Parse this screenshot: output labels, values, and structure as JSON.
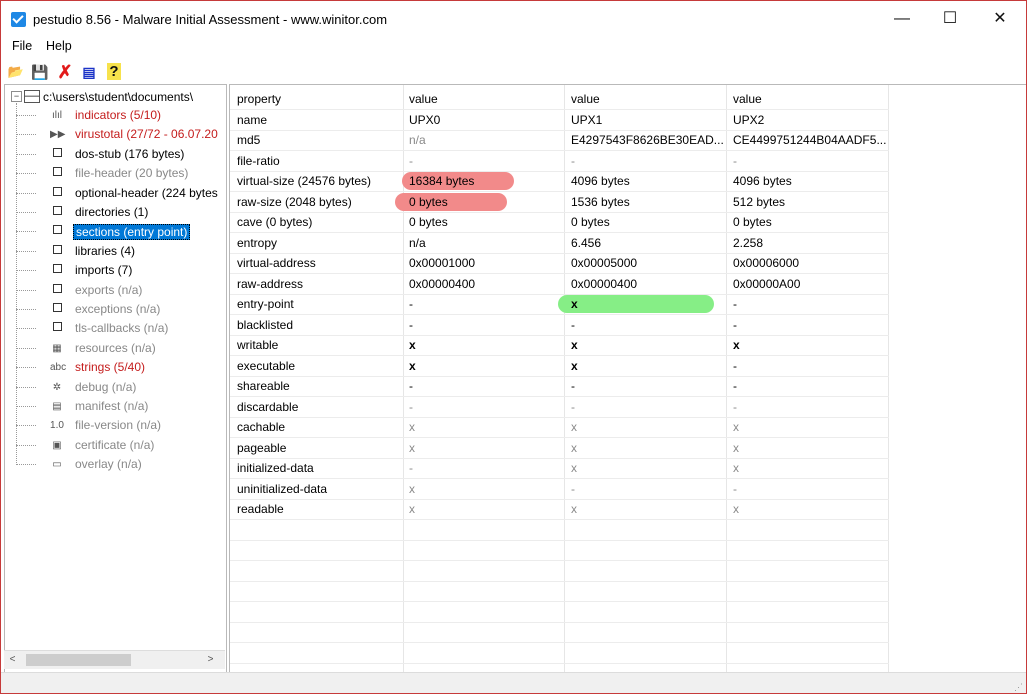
{
  "window": {
    "title": "pestudio 8.56 - Malware Initial Assessment - www.winitor.com",
    "min": "—",
    "max": "☐",
    "close": "✕"
  },
  "menu": {
    "file": "File",
    "help": "Help"
  },
  "toolbar": {
    "open_icon": "📂",
    "save_icon": "💾",
    "delete_icon": "✗",
    "list_icon": "▤",
    "help_icon": "?"
  },
  "tree": {
    "root": "c:\\users\\student\\documents\\",
    "items": [
      {
        "label": "indicators (5/10)",
        "color": "red",
        "icon": "ılıl",
        "icon_name": "bar-chart-icon"
      },
      {
        "label": "virustotal (27/72 - 06.07.20",
        "color": "red",
        "icon": "▶▶",
        "icon_name": "virustotal-icon"
      },
      {
        "label": "dos-stub (176 bytes)",
        "color": "black",
        "icon": "",
        "icon_name": "box-icon"
      },
      {
        "label": "file-header (20 bytes)",
        "color": "gray",
        "icon": "",
        "icon_name": "box-icon"
      },
      {
        "label": "optional-header (224 bytes",
        "color": "black",
        "icon": "",
        "icon_name": "box-icon"
      },
      {
        "label": "directories (1)",
        "color": "black",
        "icon": "",
        "icon_name": "box-icon"
      },
      {
        "label": "sections (entry point)",
        "color": "selected",
        "icon": "",
        "icon_name": "box-icon"
      },
      {
        "label": "libraries (4)",
        "color": "black",
        "icon": "",
        "icon_name": "box-icon"
      },
      {
        "label": "imports (7)",
        "color": "black",
        "icon": "",
        "icon_name": "box-icon"
      },
      {
        "label": "exports (n/a)",
        "color": "gray",
        "icon": "",
        "icon_name": "box-icon"
      },
      {
        "label": "exceptions (n/a)",
        "color": "gray",
        "icon": "",
        "icon_name": "box-icon"
      },
      {
        "label": "tls-callbacks (n/a)",
        "color": "gray",
        "icon": "",
        "icon_name": "box-icon"
      },
      {
        "label": "resources (n/a)",
        "color": "gray",
        "icon": "▦",
        "icon_name": "resources-icon"
      },
      {
        "label": "strings (5/40)",
        "color": "red",
        "icon": "abc",
        "icon_name": "strings-icon"
      },
      {
        "label": "debug (n/a)",
        "color": "gray",
        "icon": "✲",
        "icon_name": "bug-icon"
      },
      {
        "label": "manifest (n/a)",
        "color": "gray",
        "icon": "▤",
        "icon_name": "manifest-icon"
      },
      {
        "label": "file-version (n/a)",
        "color": "gray",
        "icon": "1.0",
        "icon_name": "version-icon"
      },
      {
        "label": "certificate (n/a)",
        "color": "gray",
        "icon": "▣",
        "icon_name": "certificate-icon"
      },
      {
        "label": "overlay (n/a)",
        "color": "gray",
        "icon": "▭",
        "icon_name": "overlay-icon"
      }
    ]
  },
  "scroll": {
    "left": "<",
    "right": ">"
  },
  "grid": {
    "headers": [
      "property",
      "value",
      "value",
      "value"
    ],
    "rows": [
      {
        "cells": [
          "name",
          "UPX0",
          "UPX1",
          "UPX2"
        ],
        "styles": [
          "b",
          "b",
          "b",
          "b"
        ]
      },
      {
        "cells": [
          "md5",
          "n/a",
          "E4297543F8626BE30EAD...",
          "CE4499751244B04AADF5..."
        ],
        "styles": [
          "b",
          "g",
          "b",
          "b"
        ]
      },
      {
        "cells": [
          "file-ratio",
          "-",
          "-",
          "-"
        ],
        "styles": [
          "b",
          "g",
          "g",
          "g"
        ]
      },
      {
        "cells": [
          "virtual-size (24576 bytes)",
          "16384 bytes",
          "4096 bytes",
          "4096 bytes"
        ],
        "styles": [
          "b",
          "b",
          "b",
          "b"
        ],
        "hl": {
          "col": 1,
          "kind": "red"
        }
      },
      {
        "cells": [
          "raw-size (2048 bytes)",
          "0 bytes",
          "1536 bytes",
          "512 bytes"
        ],
        "styles": [
          "b",
          "b",
          "b",
          "b"
        ],
        "hl": {
          "col": 0,
          "kind": "red"
        }
      },
      {
        "cells": [
          "cave (0 bytes)",
          "0 bytes",
          "0 bytes",
          "0 bytes"
        ],
        "styles": [
          "b",
          "b",
          "b",
          "b"
        ]
      },
      {
        "cells": [
          "entropy",
          "n/a",
          "6.456",
          "2.258"
        ],
        "styles": [
          "b",
          "b",
          "b",
          "b"
        ]
      },
      {
        "cells": [
          "virtual-address",
          "0x00001000",
          "0x00005000",
          "0x00006000"
        ],
        "styles": [
          "b",
          "b",
          "b",
          "b"
        ]
      },
      {
        "cells": [
          "raw-address",
          "0x00000400",
          "0x00000400",
          "0x00000A00"
        ],
        "styles": [
          "b",
          "b",
          "b",
          "b"
        ]
      },
      {
        "cells": [
          "entry-point",
          "-",
          "x",
          "-"
        ],
        "styles": [
          "b",
          "b",
          "x",
          "b"
        ],
        "hl": {
          "col": 2,
          "kind": "green"
        }
      },
      {
        "cells": [
          "blacklisted",
          "-",
          "-",
          "-"
        ],
        "styles": [
          "b",
          "b",
          "b",
          "b"
        ]
      },
      {
        "cells": [
          "writable",
          "x",
          "x",
          "x"
        ],
        "styles": [
          "b",
          "x",
          "x",
          "x"
        ]
      },
      {
        "cells": [
          "executable",
          "x",
          "x",
          "-"
        ],
        "styles": [
          "b",
          "x",
          "x",
          "b"
        ]
      },
      {
        "cells": [
          "shareable",
          "-",
          "-",
          "-"
        ],
        "styles": [
          "b",
          "b",
          "b",
          "b"
        ]
      },
      {
        "cells": [
          "discardable",
          "-",
          "-",
          "-"
        ],
        "styles": [
          "b",
          "g",
          "g",
          "g"
        ]
      },
      {
        "cells": [
          "cachable",
          "x",
          "x",
          "x"
        ],
        "styles": [
          "b",
          "g",
          "g",
          "g"
        ]
      },
      {
        "cells": [
          "pageable",
          "x",
          "x",
          "x"
        ],
        "styles": [
          "b",
          "g",
          "g",
          "g"
        ]
      },
      {
        "cells": [
          "initialized-data",
          "-",
          "x",
          "x"
        ],
        "styles": [
          "b",
          "g",
          "g",
          "g"
        ]
      },
      {
        "cells": [
          "uninitialized-data",
          "x",
          "-",
          "-"
        ],
        "styles": [
          "b",
          "g",
          "g",
          "g"
        ]
      },
      {
        "cells": [
          "readable",
          "x",
          "x",
          "x"
        ],
        "styles": [
          "b",
          "g",
          "g",
          "g"
        ]
      }
    ]
  },
  "colors": {
    "red_text": "#c41c1c",
    "selection": "#0078d7",
    "highlight_red": "#f28a8a",
    "highlight_green": "#86ee86"
  }
}
